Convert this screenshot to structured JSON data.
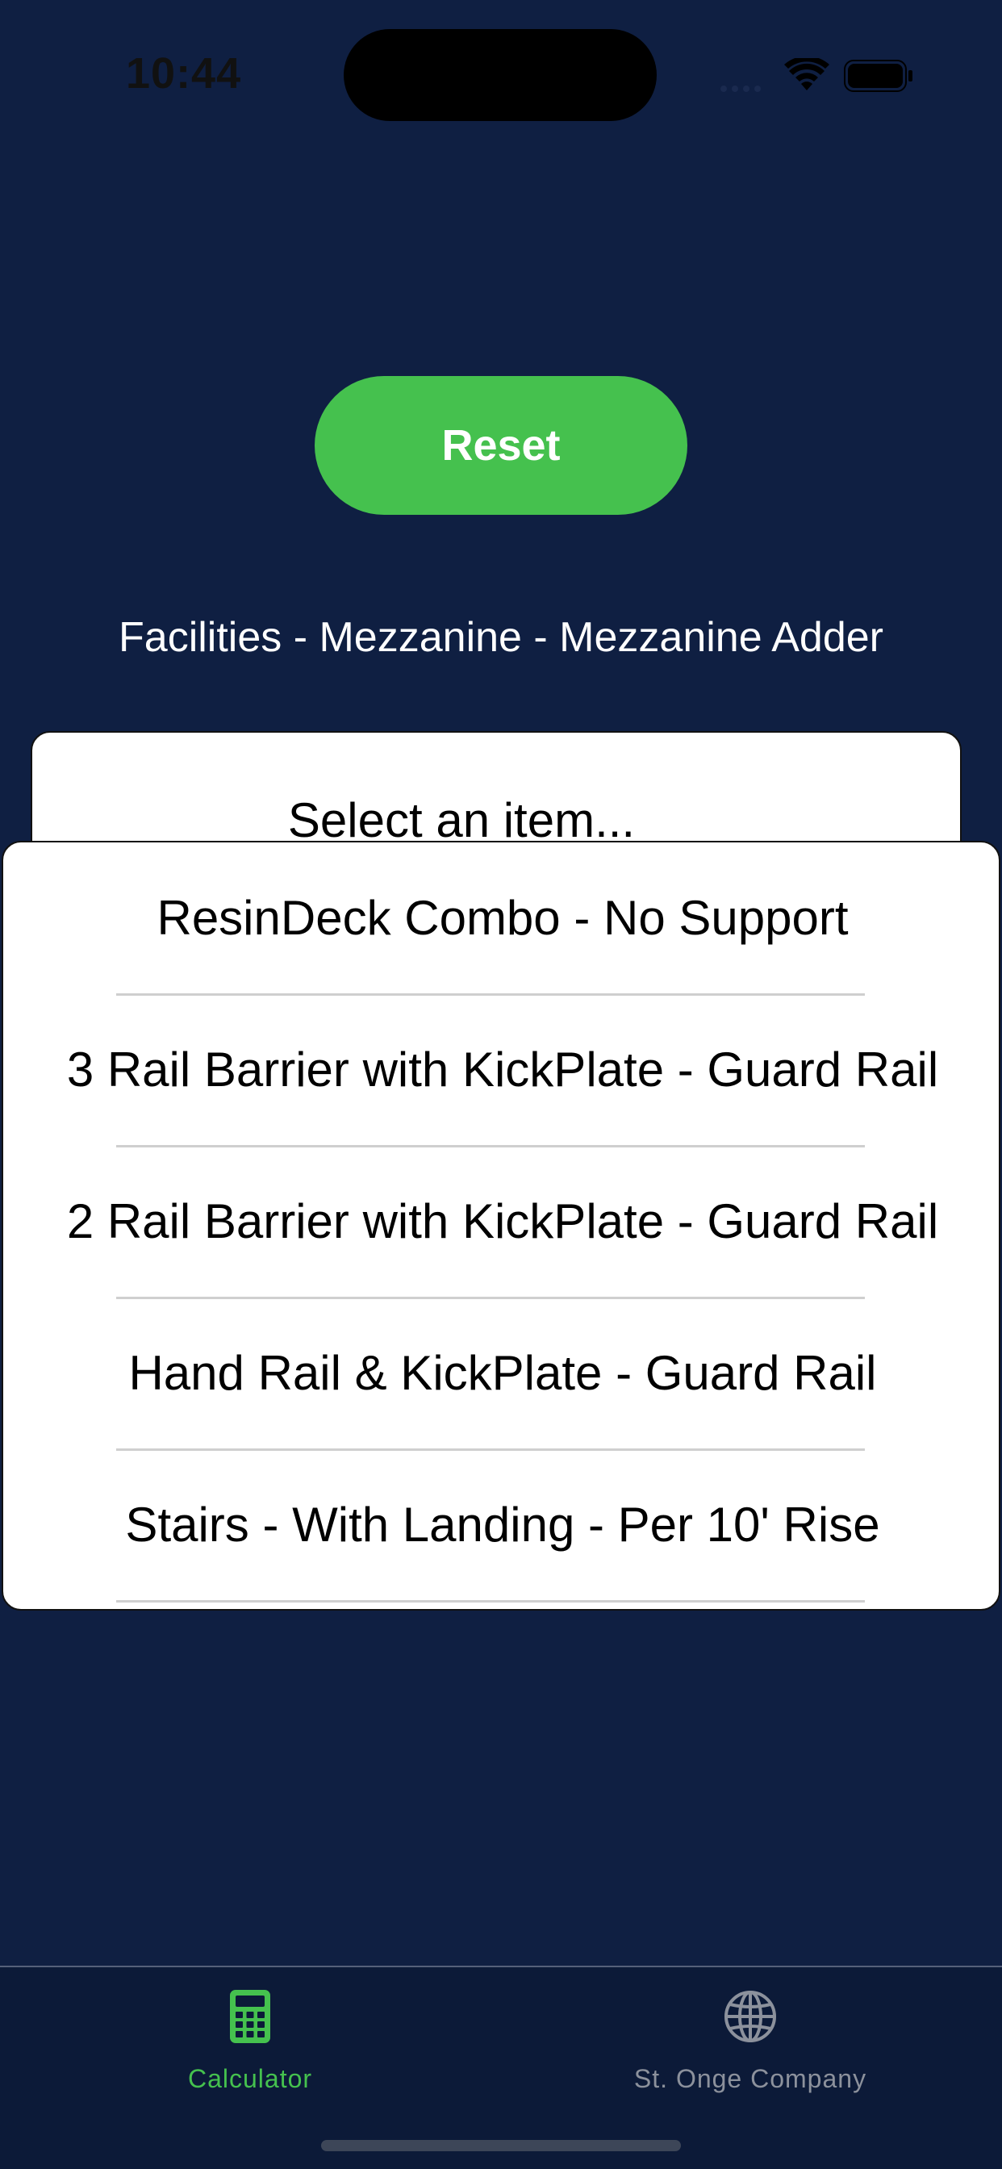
{
  "status_bar": {
    "time": "10:44",
    "icons": [
      "signal-icon",
      "wifi-icon",
      "battery-icon"
    ]
  },
  "reset_button": {
    "label": "Reset",
    "color": "#45c14e"
  },
  "breadcrumb": "Facilities - Mezzanine - Mezzanine Adder",
  "select": {
    "placeholder": "Select an item..."
  },
  "dropdown": {
    "items": [
      {
        "label": "ResinDeck Combo - No Support"
      },
      {
        "label": "3 Rail Barrier with KickPlate - Guard Rail"
      },
      {
        "label": "2 Rail Barrier with KickPlate - Guard Rail"
      },
      {
        "label": "Hand Rail &  KickPlate - Guard Rail"
      },
      {
        "label": "Stairs - With Landing - Per 10' Rise"
      }
    ]
  },
  "tab_bar": {
    "tabs": [
      {
        "label": "Calculator",
        "icon": "calculator-icon",
        "active": true
      },
      {
        "label": "St. Onge Company",
        "icon": "globe-icon",
        "active": false
      }
    ],
    "active_color": "#45c14e",
    "inactive_color": "#8c919c"
  },
  "colors": {
    "background": "#0f1f42",
    "accent": "#45c14e"
  }
}
